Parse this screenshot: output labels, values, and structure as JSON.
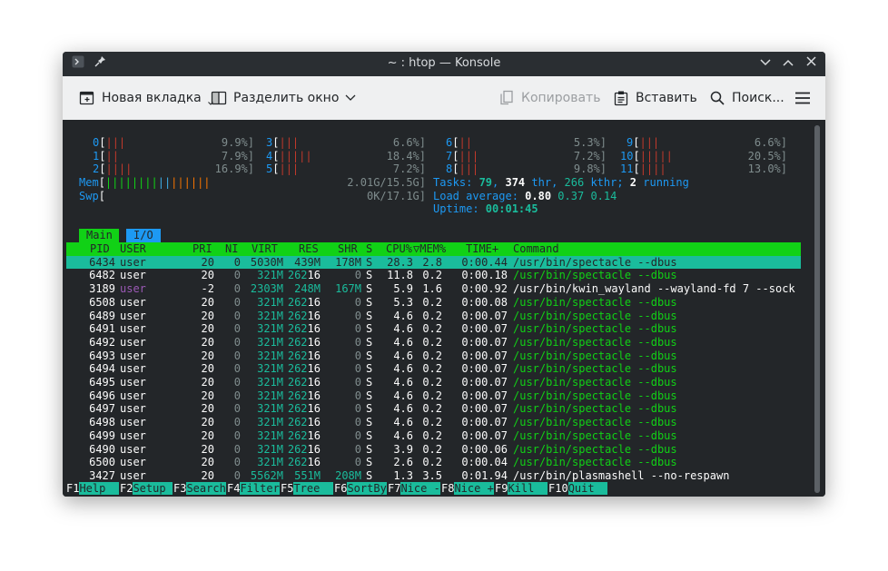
{
  "window": {
    "title": "~ : htop — Konsole"
  },
  "toolbar": {
    "new_tab": "Новая вкладка",
    "split": "Разделить окно",
    "copy": "Копировать",
    "paste": "Вставить",
    "search": "Поиск..."
  },
  "cpus": [
    {
      "label": "0",
      "bars": "|||",
      "value": "9.9%]"
    },
    {
      "label": "1",
      "bars": "||",
      "value": "7.9%]"
    },
    {
      "label": "2",
      "bars": "||||",
      "value": "16.9%]"
    },
    {
      "label": "3",
      "bars": "|||",
      "value": "6.6%]"
    },
    {
      "label": "4",
      "bars": "|||||",
      "value": "18.4%]"
    },
    {
      "label": "5",
      "bars": "|||",
      "value": "7.2%]"
    },
    {
      "label": "6",
      "bars": "||",
      "value": "5.3%]"
    },
    {
      "label": "7",
      "bars": "|||",
      "value": "7.2%]"
    },
    {
      "label": "8",
      "bars": "|||",
      "value": "9.8%]"
    },
    {
      "label": "9",
      "bars": "|||",
      "value": "6.6%]"
    },
    {
      "label": "10",
      "bars": "|||||",
      "value": "20.5%]"
    },
    {
      "label": "11",
      "bars": "||||",
      "value": "13.0%]"
    }
  ],
  "mem": {
    "label": "Mem",
    "bars": "||||||||||||||||",
    "value": "2.01G/15.5G]"
  },
  "swp": {
    "label": "Swp",
    "value": "0K/17.1G]"
  },
  "tasks": {
    "prefix": "Tasks: ",
    "count": "79",
    "sep1": ", ",
    "thr": "374",
    "thr_label": " thr, ",
    "kthr": "266",
    "kthr_label": " kthr; ",
    "running": "2",
    "running_label": " running"
  },
  "load": {
    "prefix": "Load average: ",
    "v1": "0.80",
    "v2": "0.37",
    "v3": "0.14"
  },
  "uptime": {
    "prefix": "Uptime: ",
    "value": "00:01:45"
  },
  "tabs": {
    "main": "Main",
    "io": "I/O"
  },
  "columns": [
    "PID",
    "USER",
    "PRI",
    "NI",
    "VIRT",
    "RES",
    "SHR",
    "S",
    "CPU%",
    "▽MEM%",
    "TIME+",
    "Command"
  ],
  "processes": [
    {
      "pid": "6434",
      "user": "user",
      "pri": "20",
      "ni": "0",
      "virt": "5030M",
      "res": "439M",
      "shr": "178M",
      "s": "S",
      "cpu": "28.3",
      "mem": "2.8",
      "time": "0:00.44",
      "cmd": "/usr/bin/spectacle --dbus"
    },
    {
      "pid": "6482",
      "user": "user",
      "pri": "20",
      "ni": "0",
      "virt": "321M",
      "res": "26216",
      "shr": "0",
      "s": "S",
      "cpu": "11.8",
      "mem": "0.2",
      "time": "0:00.18",
      "cmd": "/usr/bin/spectacle --dbus"
    },
    {
      "pid": "3189",
      "user": "user",
      "pri": "-2",
      "ni": "0",
      "virt": "2303M",
      "res": "248M",
      "shr": "167M",
      "s": "S",
      "cpu": "5.9",
      "mem": "1.6",
      "time": "0:00.92",
      "cmd": "/usr/bin/kwin_wayland --wayland-fd 7 --sock"
    },
    {
      "pid": "6508",
      "user": "user",
      "pri": "20",
      "ni": "0",
      "virt": "321M",
      "res": "26216",
      "shr": "0",
      "s": "S",
      "cpu": "5.3",
      "mem": "0.2",
      "time": "0:00.08",
      "cmd": "/usr/bin/spectacle --dbus"
    },
    {
      "pid": "6489",
      "user": "user",
      "pri": "20",
      "ni": "0",
      "virt": "321M",
      "res": "26216",
      "shr": "0",
      "s": "S",
      "cpu": "4.6",
      "mem": "0.2",
      "time": "0:00.07",
      "cmd": "/usr/bin/spectacle --dbus"
    },
    {
      "pid": "6491",
      "user": "user",
      "pri": "20",
      "ni": "0",
      "virt": "321M",
      "res": "26216",
      "shr": "0",
      "s": "S",
      "cpu": "4.6",
      "mem": "0.2",
      "time": "0:00.07",
      "cmd": "/usr/bin/spectacle --dbus"
    },
    {
      "pid": "6492",
      "user": "user",
      "pri": "20",
      "ni": "0",
      "virt": "321M",
      "res": "26216",
      "shr": "0",
      "s": "S",
      "cpu": "4.6",
      "mem": "0.2",
      "time": "0:00.07",
      "cmd": "/usr/bin/spectacle --dbus"
    },
    {
      "pid": "6493",
      "user": "user",
      "pri": "20",
      "ni": "0",
      "virt": "321M",
      "res": "26216",
      "shr": "0",
      "s": "S",
      "cpu": "4.6",
      "mem": "0.2",
      "time": "0:00.07",
      "cmd": "/usr/bin/spectacle --dbus"
    },
    {
      "pid": "6494",
      "user": "user",
      "pri": "20",
      "ni": "0",
      "virt": "321M",
      "res": "26216",
      "shr": "0",
      "s": "S",
      "cpu": "4.6",
      "mem": "0.2",
      "time": "0:00.07",
      "cmd": "/usr/bin/spectacle --dbus"
    },
    {
      "pid": "6495",
      "user": "user",
      "pri": "20",
      "ni": "0",
      "virt": "321M",
      "res": "26216",
      "shr": "0",
      "s": "S",
      "cpu": "4.6",
      "mem": "0.2",
      "time": "0:00.07",
      "cmd": "/usr/bin/spectacle --dbus"
    },
    {
      "pid": "6496",
      "user": "user",
      "pri": "20",
      "ni": "0",
      "virt": "321M",
      "res": "26216",
      "shr": "0",
      "s": "S",
      "cpu": "4.6",
      "mem": "0.2",
      "time": "0:00.07",
      "cmd": "/usr/bin/spectacle --dbus"
    },
    {
      "pid": "6497",
      "user": "user",
      "pri": "20",
      "ni": "0",
      "virt": "321M",
      "res": "26216",
      "shr": "0",
      "s": "S",
      "cpu": "4.6",
      "mem": "0.2",
      "time": "0:00.07",
      "cmd": "/usr/bin/spectacle --dbus"
    },
    {
      "pid": "6498",
      "user": "user",
      "pri": "20",
      "ni": "0",
      "virt": "321M",
      "res": "26216",
      "shr": "0",
      "s": "S",
      "cpu": "4.6",
      "mem": "0.2",
      "time": "0:00.07",
      "cmd": "/usr/bin/spectacle --dbus"
    },
    {
      "pid": "6499",
      "user": "user",
      "pri": "20",
      "ni": "0",
      "virt": "321M",
      "res": "26216",
      "shr": "0",
      "s": "S",
      "cpu": "4.6",
      "mem": "0.2",
      "time": "0:00.07",
      "cmd": "/usr/bin/spectacle --dbus"
    },
    {
      "pid": "6490",
      "user": "user",
      "pri": "20",
      "ni": "0",
      "virt": "321M",
      "res": "26216",
      "shr": "0",
      "s": "S",
      "cpu": "3.9",
      "mem": "0.2",
      "time": "0:00.06",
      "cmd": "/usr/bin/spectacle --dbus"
    },
    {
      "pid": "6500",
      "user": "user",
      "pri": "20",
      "ni": "0",
      "virt": "321M",
      "res": "26216",
      "shr": "0",
      "s": "S",
      "cpu": "2.6",
      "mem": "0.2",
      "time": "0:00.04",
      "cmd": "/usr/bin/spectacle --dbus"
    },
    {
      "pid": "3427",
      "user": "user",
      "pri": "20",
      "ni": "0",
      "virt": "5562M",
      "res": "551M",
      "shr": "208M",
      "s": "S",
      "cpu": "1.3",
      "mem": "3.5",
      "time": "0:01.94",
      "cmd": "/usr/bin/plasmashell --no-respawn"
    }
  ],
  "fkeys": [
    {
      "key": "F1",
      "label": "Help  "
    },
    {
      "key": "F2",
      "label": "Setup "
    },
    {
      "key": "F3",
      "label": "Search"
    },
    {
      "key": "F4",
      "label": "Filter"
    },
    {
      "key": "F5",
      "label": "Tree  "
    },
    {
      "key": "F6",
      "label": "SortBy"
    },
    {
      "key": "F7",
      "label": "Nice -"
    },
    {
      "key": "F8",
      "label": "Nice +"
    },
    {
      "key": "F9",
      "label": "Kill  "
    },
    {
      "key": "F10",
      "label": "Quit  "
    }
  ],
  "colors": {
    "accent": "#1abc9c",
    "header_green": "#11d116",
    "io_blue": "#1d99f3",
    "terminal_bg": "#232629"
  }
}
